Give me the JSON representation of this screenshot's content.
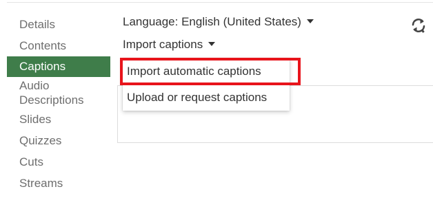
{
  "sidebar": {
    "items": [
      {
        "label": "Details"
      },
      {
        "label": "Contents"
      },
      {
        "label": "Captions"
      },
      {
        "label": "Audio Descriptions"
      },
      {
        "label": "Slides"
      },
      {
        "label": "Quizzes"
      },
      {
        "label": "Cuts"
      },
      {
        "label": "Streams"
      }
    ],
    "active": "Captions"
  },
  "main": {
    "language_select": {
      "label": "Language: English (United States)"
    },
    "import_select": {
      "label": "Import captions"
    },
    "refresh_icon": "refresh-icon"
  },
  "dropdown": {
    "items": [
      {
        "label": "Import automatic captions",
        "highlighted": true
      },
      {
        "label": "Upload or request captions"
      }
    ]
  },
  "colors": {
    "active_sidebar_bg": "#3f7d4a",
    "highlight_border": "#e8141b"
  }
}
